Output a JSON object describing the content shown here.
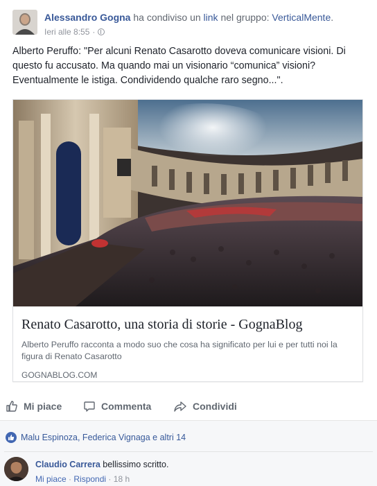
{
  "post": {
    "author": "Alessandro Gogna",
    "action_pre": "ha condiviso un",
    "action_link": "link",
    "action_mid": "nel gruppo:",
    "group": "VerticalMente",
    "action_end": ".",
    "timestamp": "Ieri alle 8:55",
    "meta_sep": "·",
    "audience_icon": "globe-icon",
    "text": "Alberto Peruffo: \"Per alcuni Renato Casarotto doveva comunicare visioni. Di questo fu accusato. Ma quando mai un visionario “comunica” visioni? Eventualmente le istiga. Condividendo qualche raro segno...\"."
  },
  "link_card": {
    "image_icon": "theater-photo",
    "title": "Renato Casarotto, una storia di storie - GognaBlog",
    "description": "Alberto Peruffo racconta a modo suo che cosa ha significato per lui e per tutti noi la figura di Renato Casarotto",
    "domain": "GOGNABLOG.COM"
  },
  "actions": {
    "like": "Mi piace",
    "comment": "Commenta",
    "share": "Condividi"
  },
  "reactions": {
    "text": "Malu Espinoza, Federica Vignaga e altri 14"
  },
  "comment": {
    "author": "Claudio Carrera",
    "text": "bellissimo scritto.",
    "like": "Mi piace",
    "sep": "·",
    "reply": "Rispondi",
    "time": "18 h"
  },
  "colors": {
    "link": "#385898",
    "like_badge": "#4267b2",
    "footer_bg": "#f6f7f9"
  }
}
